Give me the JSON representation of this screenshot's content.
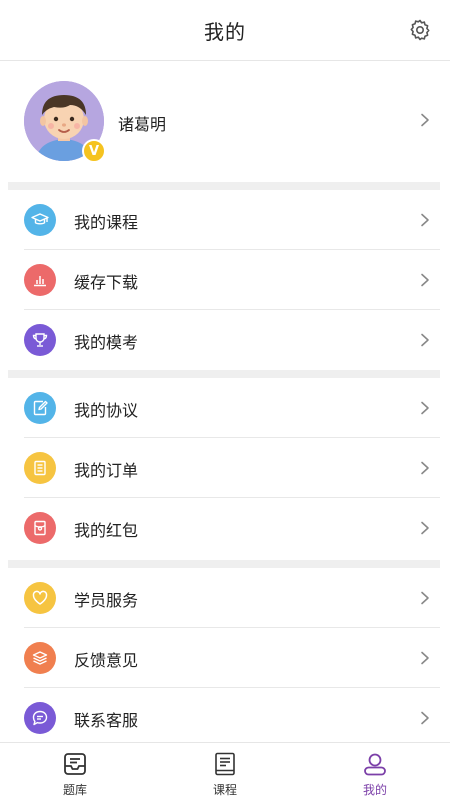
{
  "header": {
    "title": "我的"
  },
  "profile": {
    "name": "诸葛明",
    "badge": "V"
  },
  "sections": [
    {
      "items": [
        {
          "label": "我的课程",
          "icon": "graduation-cap-icon",
          "color": "#53b4e8"
        },
        {
          "label": "缓存下载",
          "icon": "bar-chart-icon",
          "color": "#ec6a6a"
        },
        {
          "label": "我的模考",
          "icon": "trophy-icon",
          "color": "#7a5ad6"
        }
      ]
    },
    {
      "items": [
        {
          "label": "我的协议",
          "icon": "edit-document-icon",
          "color": "#53b4e8"
        },
        {
          "label": "我的订单",
          "icon": "list-document-icon",
          "color": "#f6c441"
        },
        {
          "label": "我的红包",
          "icon": "red-envelope-icon",
          "color": "#ec6a6a"
        }
      ]
    },
    {
      "items": [
        {
          "label": "学员服务",
          "icon": "heart-icon",
          "color": "#f6c441"
        },
        {
          "label": "反馈意见",
          "icon": "stack-icon",
          "color": "#f07f4f"
        },
        {
          "label": "联系客服",
          "icon": "chat-bubble-icon",
          "color": "#7a5ad6"
        }
      ]
    }
  ],
  "tabbar": {
    "tabs": [
      {
        "label": "题库",
        "icon": "inbox-tray-icon",
        "active": false
      },
      {
        "label": "课程",
        "icon": "book-icon",
        "active": false
      },
      {
        "label": "我的",
        "icon": "user-icon",
        "active": true
      }
    ],
    "active_color": "#7b3fa8"
  }
}
